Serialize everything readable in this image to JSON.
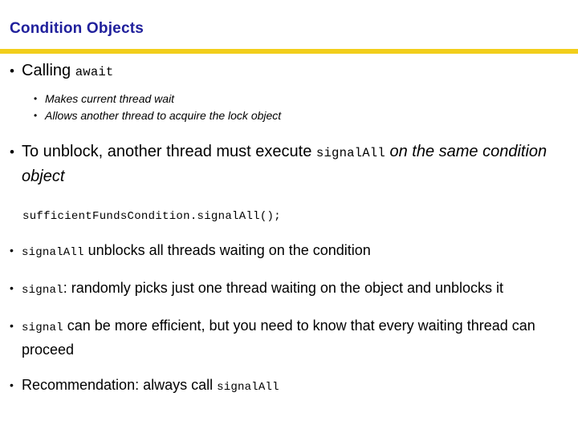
{
  "slide": {
    "title": "Condition Objects",
    "accent_color_title": "#20209C",
    "accent_color_rule": "#F2CE1B",
    "background_color": "#FFFFFF",
    "bullet_glyph": "•"
  },
  "content": {
    "bullet1": {
      "text_before": "Calling ",
      "code": "await"
    },
    "sub_bullets": [
      {
        "text": "Makes current thread wait"
      },
      {
        "text": "Allows another thread to acquire the lock object"
      }
    ],
    "bullet2": {
      "text_before": "To unblock, another thread must execute ",
      "code": "signalAll",
      "text_after_italic": " on the same condition object"
    },
    "code_line": "sufficientFundsCondition.signalAll();",
    "bullet3": {
      "code": "signalAll",
      "text_after": " unblocks all threads waiting on the condition"
    },
    "bullet4": {
      "code": "signal",
      "text_after": ": randomly picks just one thread waiting on the object and unblocks it"
    },
    "bullet5": {
      "code": "signal",
      "text_after": " can be more efficient, but you need to know that every waiting thread can proceed"
    },
    "bullet6": {
      "text_before": "Recommendation: always call ",
      "code": "signalAll"
    }
  }
}
